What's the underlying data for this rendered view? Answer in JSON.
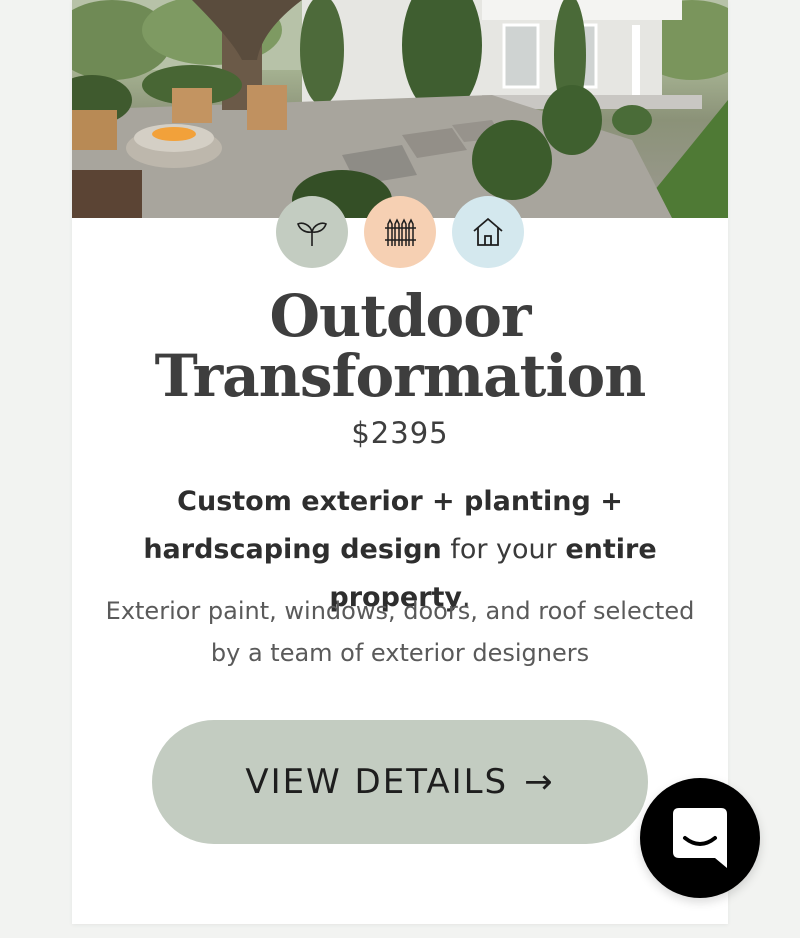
{
  "hero": {
    "image_alt": "Rendered backyard with fire pit, adirondack chairs and house"
  },
  "categories": [
    {
      "icon": "sprout-icon",
      "color": "#c3ccc1"
    },
    {
      "icon": "fence-icon",
      "color": "#f6d0b3"
    },
    {
      "icon": "house-icon",
      "color": "#d4e8ee"
    }
  ],
  "product": {
    "title_line1": "Outdoor",
    "title_line2": "Transformation",
    "price": "$2395",
    "tagline": {
      "part1": "Custom exterior + planting + hardscaping design",
      "part2": " for your ",
      "part3": "entire property",
      "part4": "."
    },
    "description": "Exterior paint, windows, doors, and roof selected by a team of exterior designers"
  },
  "cta": {
    "label": "VIEW DETAILS",
    "arrow": "→"
  },
  "chat": {
    "icon": "chat-bubble-icon"
  },
  "colors": {
    "sage": "#c3ccc1",
    "peach": "#f6d0b3",
    "light_blue": "#d4e8ee",
    "text_dark": "#3e3e3e"
  }
}
